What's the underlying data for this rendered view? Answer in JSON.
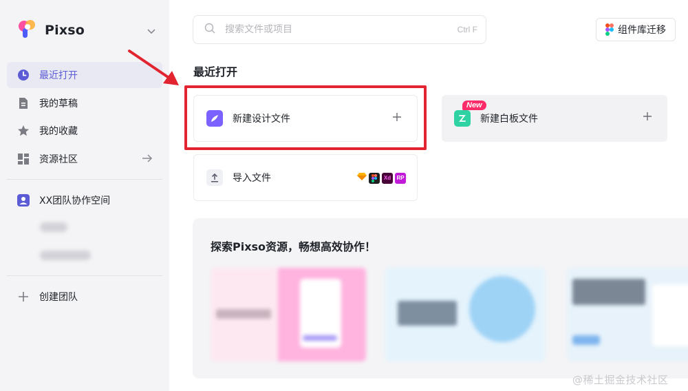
{
  "brand": {
    "name": "Pixso"
  },
  "nav": {
    "recent": "最近打开",
    "drafts": "我的草稿",
    "favorites": "我的收藏",
    "community": "资源社区",
    "team": "XX团队协作空间",
    "create_team": "创建团队"
  },
  "search": {
    "placeholder": "搜索文件或项目",
    "shortcut": "Ctrl F"
  },
  "migrate": {
    "label": "组件库迁移"
  },
  "recent": {
    "title": "最近打开",
    "new_design": "新建设计文件",
    "new_whiteboard": "新建白板文件",
    "new_badge": "New",
    "import": "导入文件",
    "import_formats": [
      "Sketch",
      "Figma",
      "Xd",
      "RP"
    ]
  },
  "explore": {
    "title": "探索Pixso资源，畅想高效协作！"
  },
  "watermark": "@稀土掘金技术社区",
  "colors": {
    "accent": "#5b5bd6",
    "highlight": "#e12430",
    "whiteboard": "#2fd3a3",
    "badge": "#ff2c6a"
  }
}
